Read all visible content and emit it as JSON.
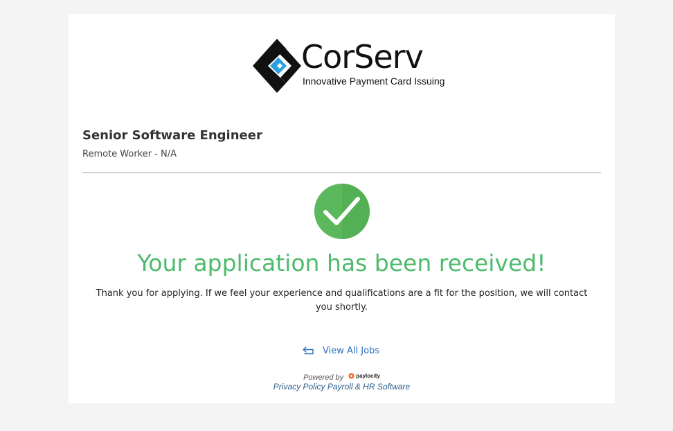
{
  "logo": {
    "name": "CorServ",
    "tagline": "Innovative Payment Card Issuing",
    "colors": {
      "mark_dark": "#111111",
      "mark_accent": "#2b9fe0"
    }
  },
  "job": {
    "title": "Senior Software Engineer",
    "location": "Remote Worker - N/A"
  },
  "confirmation": {
    "icon": "checkmark-circle-icon",
    "headline": "Your application has been received!",
    "message": "Thank you for applying. If we feel your experience and qualifications are a fit for the position, we will contact you shortly.",
    "colors": {
      "success": "#4dbb6c",
      "circle": "#5cb85c"
    }
  },
  "actions": {
    "view_all_jobs": {
      "label": "View All Jobs",
      "icon": "return-arrow-icon"
    }
  },
  "footer": {
    "powered_by": "Powered by",
    "provider": "paylocity",
    "privacy_policy": "Privacy Policy",
    "payroll_link": "Payroll & HR Software"
  },
  "colors": {
    "page_bg": "#f4f4f4",
    "card_bg": "#ffffff",
    "link": "#2a6fb8"
  }
}
